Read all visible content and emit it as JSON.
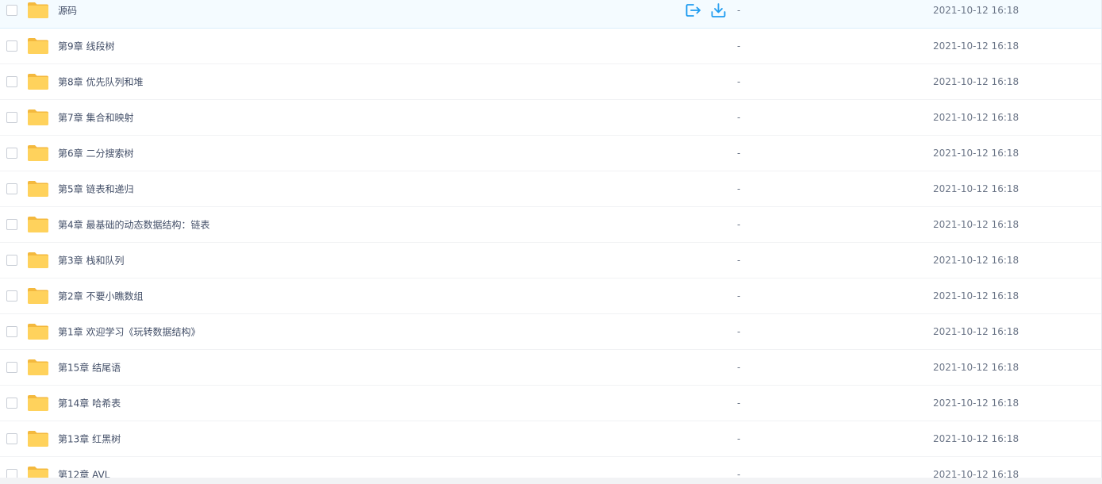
{
  "colors": {
    "accent": "#1f9cf0",
    "folder": "#ffd25c",
    "folder_dark": "#f4b93e",
    "row_hover": "#f4fbff"
  },
  "hovered_row": {
    "name": "源码",
    "size": "-",
    "modified": "2021-10-12 16:18",
    "actions": [
      {
        "icon": "share-out-icon"
      },
      {
        "icon": "download-icon"
      }
    ]
  },
  "rows": [
    {
      "name": "第9章 线段树",
      "size": "-",
      "modified": "2021-10-12 16:18"
    },
    {
      "name": "第8章 优先队列和堆",
      "size": "-",
      "modified": "2021-10-12 16:18"
    },
    {
      "name": "第7章 集合和映射",
      "size": "-",
      "modified": "2021-10-12 16:18"
    },
    {
      "name": "第6章 二分搜索树",
      "size": "-",
      "modified": "2021-10-12 16:18"
    },
    {
      "name": "第5章 链表和递归",
      "size": "-",
      "modified": "2021-10-12 16:18"
    },
    {
      "name": "第4章 最基础的动态数据结构：链表",
      "size": "-",
      "modified": "2021-10-12 16:18"
    },
    {
      "name": "第3章 栈和队列",
      "size": "-",
      "modified": "2021-10-12 16:18"
    },
    {
      "name": "第2章 不要小瞧数组",
      "size": "-",
      "modified": "2021-10-12 16:18"
    },
    {
      "name": "第1章 欢迎学习《玩转数据结构》",
      "size": "-",
      "modified": "2021-10-12 16:18"
    },
    {
      "name": "第15章 结尾语",
      "size": "-",
      "modified": "2021-10-12 16:18"
    },
    {
      "name": "第14章 哈希表",
      "size": "-",
      "modified": "2021-10-12 16:18"
    },
    {
      "name": "第13章 红黑树",
      "size": "-",
      "modified": "2021-10-12 16:18"
    },
    {
      "name": "第12章 AVL",
      "size": "-",
      "modified": "2021-10-12 16:18"
    }
  ]
}
